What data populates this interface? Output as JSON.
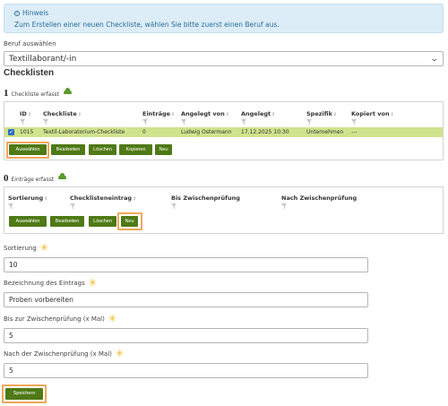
{
  "hint": {
    "title": "Hinweis",
    "text": "Zum Erstellen einer neuen Checkliste, wählen Sie bitte zuerst einen Beruf aus."
  },
  "beruf": {
    "label": "Beruf auswählen",
    "value": "Textillaborant/-in"
  },
  "checklisten": {
    "heading": "Checklisten",
    "count": "1",
    "count_text": "Checkliste erfasst",
    "columns": [
      "ID",
      "Checkliste",
      "Einträge",
      "Angelegt von",
      "Angelegt",
      "Spezifik",
      "Kopiert von"
    ],
    "row": [
      "1015",
      "Textil-Laboratorium-Checkliste",
      "0",
      "Ludwig Ostermann",
      "17.12.2025 10:30",
      "Unternehmen",
      "---"
    ],
    "buttons": [
      "Auswählen",
      "Bearbeiten",
      "Löschen",
      "Kopieren",
      "Neu"
    ]
  },
  "eintraege": {
    "count": "0",
    "count_text": "Einträge erfasst",
    "columns": [
      "Sortierung",
      "Checklisteneintrag",
      "Bis Zwischenprüfung",
      "Nach Zwischenprüfung"
    ],
    "buttons": [
      "Auswählen",
      "Bearbeiten",
      "Löschen",
      "Neu"
    ]
  },
  "form": {
    "sortierung": {
      "label": "Sortierung",
      "value": "10"
    },
    "bezeichnung": {
      "label": "Bezeichnung des Eintrags",
      "value": "Proben vorbereiten"
    },
    "bis": {
      "label": "Bis zur Zwischenprüfung (x Mal)",
      "value": "5"
    },
    "nach": {
      "label": "Nach der Zwischenprüfung (x Mal)",
      "value": "5"
    },
    "save_label": "Speichern"
  },
  "colors": {
    "accent_green": "#4f7a16",
    "row_highlight": "#cfe38d",
    "callout_orange": "#f0a85a",
    "required_star": "#f2b81a"
  }
}
